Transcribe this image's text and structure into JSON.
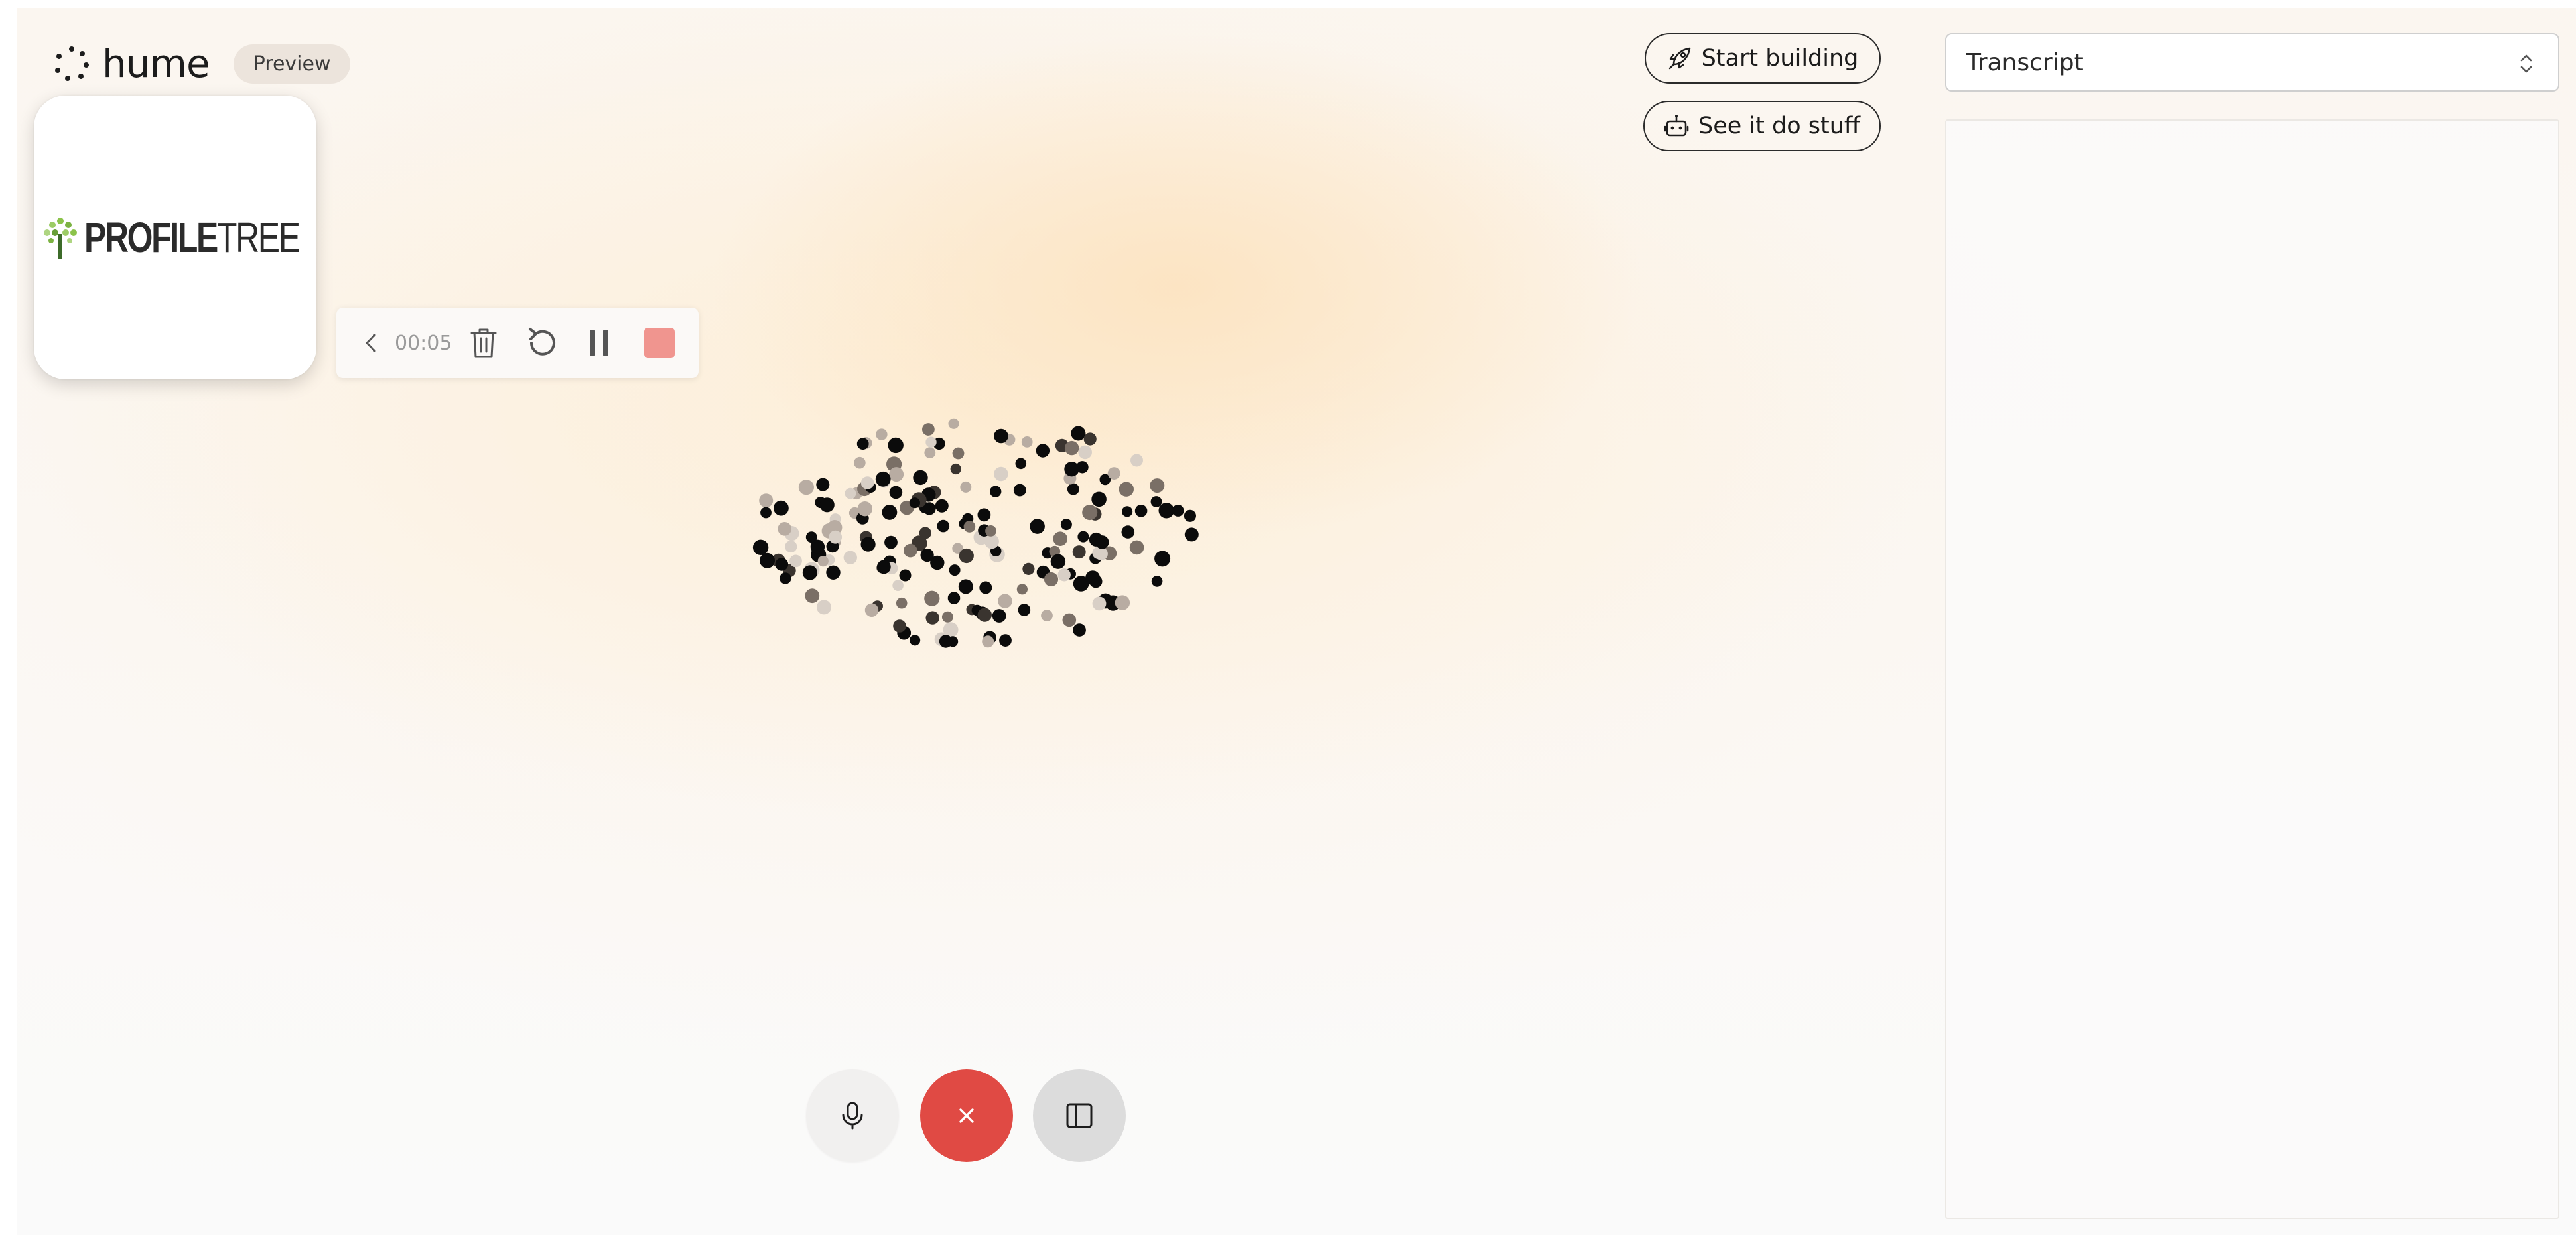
{
  "brand": {
    "name": "hume",
    "badge": "Preview",
    "icon": "hume-dots-icon"
  },
  "avatar": {
    "logo_text_bold": "PROFILE",
    "logo_text_light": "TREE",
    "logo_icon": "tree-icon",
    "tree_color": "#7cb342"
  },
  "recorder": {
    "time": "00:05",
    "icons": [
      "chevron-left-icon",
      "trash-icon",
      "restart-icon",
      "pause-icon",
      "stop-icon"
    ],
    "stop_color": "#f0958f"
  },
  "header_actions": {
    "start_building": "Start building",
    "start_building_icon": "rocket-icon",
    "see_it_do_stuff": "See it do stuff",
    "see_it_do_stuff_icon": "robot-icon"
  },
  "transcript": {
    "selected": "Transcript",
    "icon": "select-arrows-icon"
  },
  "controls": {
    "mic_icon": "microphone-icon",
    "end_icon": "close-icon",
    "panel_icon": "sidebar-toggle-icon",
    "end_color": "#e04a44"
  },
  "accent_colors": {
    "end_call": "#e04a44",
    "stop": "#f0958f",
    "badge_bg": "#ece4dc"
  }
}
